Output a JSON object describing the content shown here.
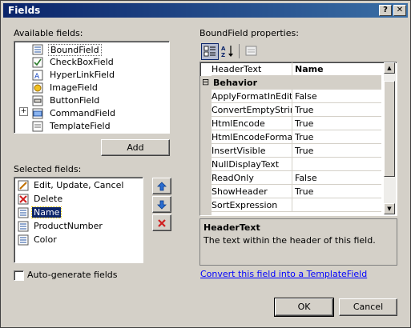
{
  "window": {
    "title": "Fields"
  },
  "available": {
    "label": "Available fields:",
    "items": [
      {
        "label": "BoundField",
        "icon": "bound-field-icon"
      },
      {
        "label": "CheckBoxField",
        "icon": "checkbox-field-icon"
      },
      {
        "label": "HyperLinkField",
        "icon": "hyperlink-field-icon"
      },
      {
        "label": "ImageField",
        "icon": "image-field-icon"
      },
      {
        "label": "ButtonField",
        "icon": "button-field-icon"
      },
      {
        "label": "CommandField",
        "icon": "command-field-icon",
        "expandable": "+"
      },
      {
        "label": "TemplateField",
        "icon": "template-field-icon"
      }
    ],
    "add_label": "Add"
  },
  "selected": {
    "label": "Selected fields:",
    "items": [
      {
        "label": "Edit, Update, Cancel",
        "icon": "edit-field-icon"
      },
      {
        "label": "Delete",
        "icon": "delete-field-icon"
      },
      {
        "label": "Name",
        "icon": "bound-field-icon",
        "selected": true
      },
      {
        "label": "ProductNumber",
        "icon": "bound-field-icon"
      },
      {
        "label": "Color",
        "icon": "bound-field-icon"
      }
    ]
  },
  "properties": {
    "label": "BoundField properties:",
    "header_row": {
      "name": "HeaderText",
      "value": "Name"
    },
    "category": "Behavior",
    "category_toggle": "⊟",
    "rows": [
      {
        "name": "ApplyFormatInEditM",
        "value": "False"
      },
      {
        "name": "ConvertEmptyString",
        "value": "True"
      },
      {
        "name": "HtmlEncode",
        "value": "True"
      },
      {
        "name": "HtmlEncodeFormatS",
        "value": "True"
      },
      {
        "name": "InsertVisible",
        "value": "True"
      },
      {
        "name": "NullDisplayText",
        "value": ""
      },
      {
        "name": "ReadOnly",
        "value": "False"
      },
      {
        "name": "ShowHeader",
        "value": "True"
      },
      {
        "name": "SortExpression",
        "value": ""
      }
    ],
    "description_title": "HeaderText",
    "description_text": "The text within the header of this field."
  },
  "auto_generate": {
    "label": "Auto-generate fields",
    "checked": false
  },
  "convert_link": "Convert this field into a TemplateField",
  "ok_label": "OK",
  "cancel_label": "Cancel",
  "close_glyph": "✕",
  "help_glyph": "?",
  "colors": {
    "titlebar": "#0a246a",
    "selection": "#0a246a",
    "link": "#0000ff",
    "face": "#d4d0c8"
  }
}
